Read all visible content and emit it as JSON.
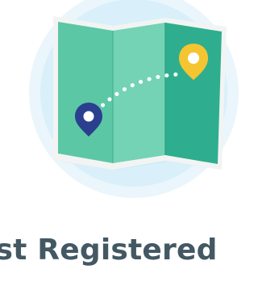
{
  "screen": {
    "heading": "ist Registered"
  },
  "illustration": {
    "icon": "map-route-icon",
    "start_pin_icon": "location-pin-icon",
    "end_pin_icon": "location-pin-icon",
    "colors": {
      "halo_outer": "#eaf6fc",
      "halo_inner": "#d9f0fa",
      "map_left_panel": "#5cc7a4",
      "map_middle_panel": "#73d3b4",
      "map_right_panel": "#2fae8f",
      "map_border": "#f2f4f3",
      "route_dots": "#ffffff",
      "start_pin": "#2b3f8f",
      "end_pin": "#f4c531"
    }
  }
}
